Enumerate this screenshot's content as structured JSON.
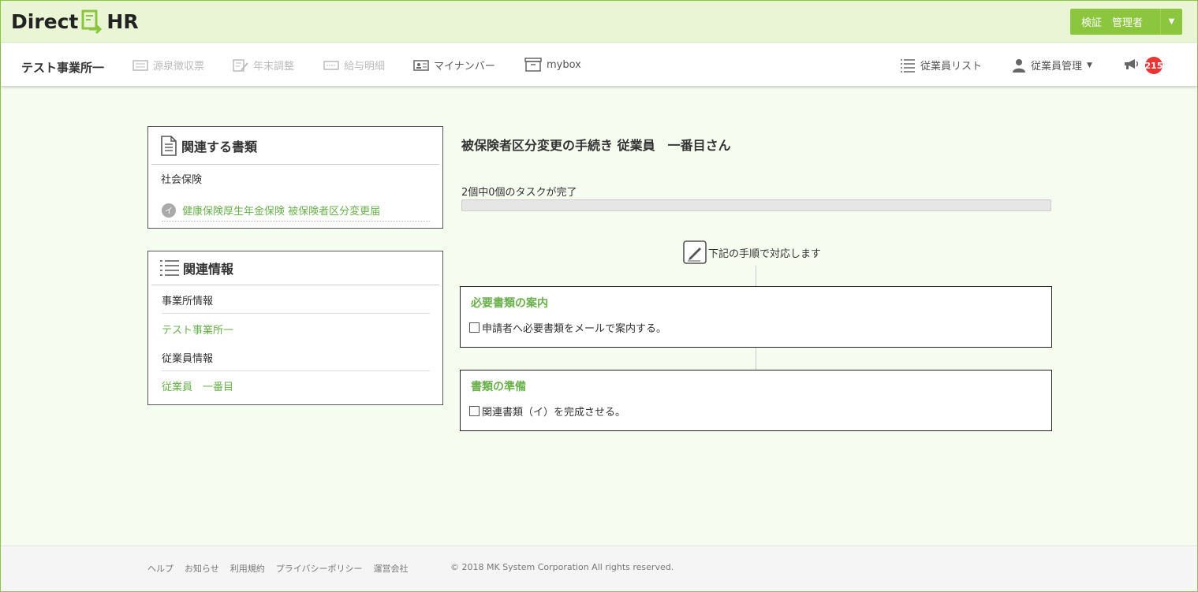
{
  "app": {
    "logo_left": "Direct",
    "logo_right": "HR",
    "user_button": "検証　管理者"
  },
  "nav": {
    "office_name": "テスト事業所一",
    "items": [
      {
        "label": "源泉徴収票",
        "icon": "receipt-icon",
        "enabled": false
      },
      {
        "label": "年末調整",
        "icon": "edit-document-icon",
        "enabled": false
      },
      {
        "label": "給与明細",
        "icon": "payslip-icon",
        "enabled": false
      },
      {
        "label": "マイナンバー",
        "icon": "id-card-icon",
        "enabled": true
      },
      {
        "label": "mybox",
        "icon": "box-icon",
        "enabled": true
      }
    ],
    "right_items": [
      {
        "label": "従業員リスト",
        "icon": "list-icon"
      },
      {
        "label": "従業員管理",
        "icon": "person-icon"
      }
    ],
    "notification_count": "215"
  },
  "related_docs": {
    "title": "関連する書類",
    "category": "社会保険",
    "doc_marker": "イ",
    "doc_link": "健康保険厚生年金保険 被保険者区分変更届"
  },
  "related_info": {
    "title": "関連情報",
    "office_label": "事業所情報",
    "office_link": "テスト事業所一",
    "employee_label": "従業員情報",
    "employee_link": "従業員　一番目"
  },
  "main": {
    "title": "被保険者区分変更の手続き  従業員　一番目さん",
    "task_status": "2個中0個のタスクが完了",
    "progress": 0,
    "step_header": "下記の手順で対応します",
    "steps": [
      {
        "title": "必要書類の案内",
        "task": "申請者へ必要書類をメールで案内する。",
        "done": false
      },
      {
        "title": "書類の準備",
        "task": "関連書類（イ）を完成させる。",
        "done": false
      }
    ]
  },
  "footer": {
    "links": [
      "ヘルプ",
      "お知らせ",
      "利用規約",
      "プライバシーポリシー",
      "運営会社"
    ],
    "copyright": "© 2018 MK System Corporation All rights reserved."
  },
  "colors": {
    "brand_green": "#8cc63f",
    "link_green": "#6ab04c",
    "badge_red": "#e33333"
  }
}
